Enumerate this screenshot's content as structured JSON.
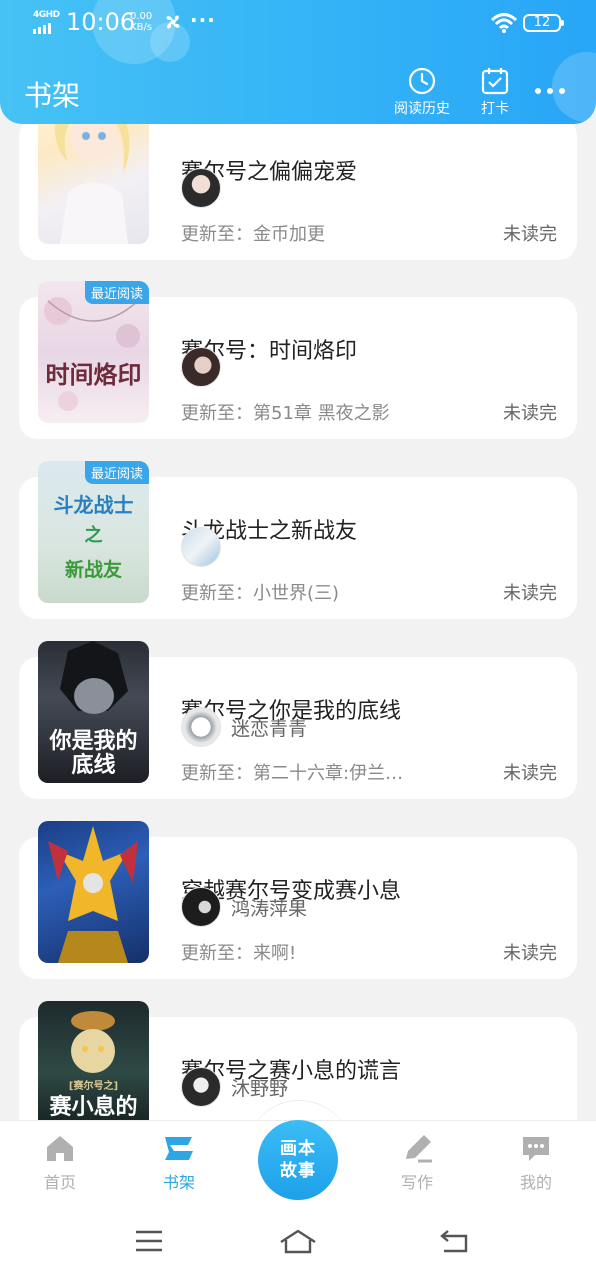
{
  "status_bar": {
    "network": "4GHD",
    "time": "10:06",
    "speed_value": "0.00",
    "speed_unit": "KB/s",
    "more": "···",
    "battery": "12"
  },
  "header": {
    "title": "书架",
    "history_label": "阅读历史",
    "checkin_label": "打卡"
  },
  "books": [
    {
      "title": "赛尔号之偏偏宠爱",
      "author": "",
      "update": "更新至：金币加更",
      "status": "未读完",
      "badge": "",
      "cover_text": ""
    },
    {
      "title": "赛尔号：时间烙印",
      "author": "",
      "update": "更新至：第51章 黑夜之影",
      "status": "未读完",
      "badge": "最近阅读",
      "cover_text": "时间烙印"
    },
    {
      "title": "斗龙战士之新战友",
      "author": "",
      "update": "更新至：小世界(三)",
      "status": "未读完",
      "badge": "最近阅读",
      "cover_text_1": "斗龙战士",
      "cover_text_2": "之",
      "cover_text_3": "新战友"
    },
    {
      "title": "赛尔号之你是我的底线",
      "author": "迷恋青青",
      "update": "更新至：第二十六章:伊兰…",
      "status": "未读完",
      "badge": "",
      "cover_text": "你是我的底线"
    },
    {
      "title": "穿越赛尔号变成赛小息",
      "author": "鸿涛萍果",
      "update": "更新至：来啊!",
      "status": "未读完",
      "badge": "",
      "cover_text": ""
    },
    {
      "title": "赛尔号之赛小息的谎言",
      "author": "沐野野",
      "update": "",
      "status": "",
      "badge": "",
      "cover_text_small": "[赛尔号之]",
      "cover_text": "赛小息的"
    }
  ],
  "bottom_nav": {
    "home": "首页",
    "shelf": "书架",
    "center_line1": "画本",
    "center_line2": "故事",
    "write": "写作",
    "mine": "我的"
  },
  "colors": {
    "header": "#34b3f7",
    "accent": "#2da6e6",
    "badge": "#3aa6e8"
  }
}
